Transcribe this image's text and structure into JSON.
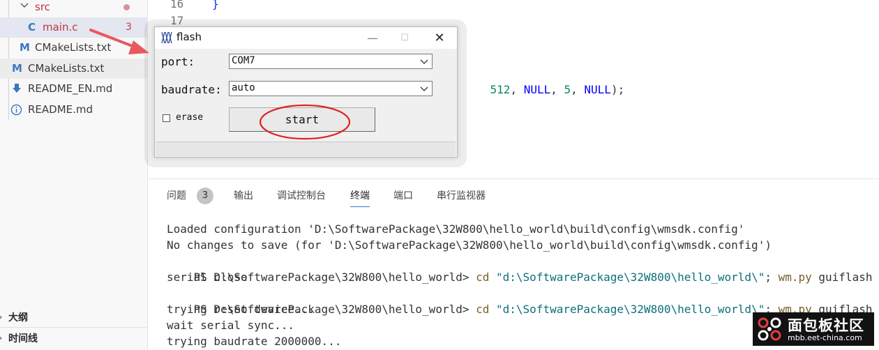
{
  "explorer": {
    "items": [
      {
        "label": "src",
        "icon": "chevron-down-icon",
        "status": "modified-dot"
      },
      {
        "label": "main.c",
        "icon": "c-file-icon",
        "icon_glyph": "C",
        "badge": "3"
      },
      {
        "label": "CMakeLists.txt",
        "icon": "cmake-file-icon",
        "icon_glyph": "M"
      },
      {
        "label": "CMakeLists.txt",
        "icon": "cmake-file-icon",
        "icon_glyph": "M"
      },
      {
        "label": "README_EN.md",
        "icon": "download-arrow-icon",
        "icon_glyph": "⬇"
      },
      {
        "label": "README.md",
        "icon": "info-icon",
        "icon_glyph": "ⓘ"
      }
    ],
    "outline_label": "大纲",
    "timeline_label": "时间线",
    "colors": {
      "c_icon": "#3a78c2",
      "error": "#c73c4c",
      "cmake_icon": "#3a78c2"
    }
  },
  "editor": {
    "line_numbers": [
      "16",
      "17"
    ],
    "brace": "}",
    "code_fragment": {
      "num1": "512",
      "sep1": ", ",
      "null1": "NULL",
      "sep2": ", ",
      "num2": "5",
      "sep3": ", ",
      "null2": "NULL",
      "end": ");"
    }
  },
  "panel": {
    "tabs": [
      {
        "label": "问题",
        "badge": "3"
      },
      {
        "label": "输出"
      },
      {
        "label": "调试控制台"
      },
      {
        "label": "终端",
        "active": true
      },
      {
        "label": "端口"
      },
      {
        "label": "串行监视器"
      }
    ],
    "terminal": {
      "line1": "Loaded configuration 'D:\\SoftwarePackage\\32W800\\hello_world\\build\\config\\wmsdk.config'",
      "line2": "No changes to save (for 'D:\\SoftwarePackage\\32W800\\hello_world\\build\\config\\wmsdk.config')",
      "line3": {
        "prompt": "PS D:\\SoftwarePackage\\32W800\\hello_world> ",
        "cmd": "cd ",
        "path": "\"d:\\SoftwarePackage\\32W800\\hello_world\\\"",
        "tail1": "; ",
        "exe": "wm.py",
        "arg": " guiflash"
      },
      "line4": "serial close",
      "line5": {
        "prompt": "PS D:\\SoftwarePackage\\32W800\\hello_world> ",
        "cmd": "cd ",
        "path": "\"d:\\SoftwarePackage\\32W800\\hello_world\\\"",
        "tail1": "; ",
        "exe": "wm.py",
        "arg": " guiflash"
      },
      "line6": "trying reset device...",
      "line7": "wait serial sync...",
      "line8": "trying baudrate 2000000..."
    }
  },
  "dialog": {
    "title": "flash",
    "logo_icon": "wm-logo-icon",
    "minimize": "—",
    "maximize": "☐",
    "close": "✕",
    "port_label": "port:",
    "port_value": "COM7",
    "baudrate_label": "baudrate:",
    "baudrate_value": "auto",
    "erase_label": "erase",
    "erase_checked": false,
    "start_label": "start"
  },
  "annotations": {
    "arrow_color": "#e8585c",
    "ellipse_color": "#e02020"
  },
  "watermark": {
    "title": "面包板社区",
    "url": "mbb.eet-china.com"
  }
}
